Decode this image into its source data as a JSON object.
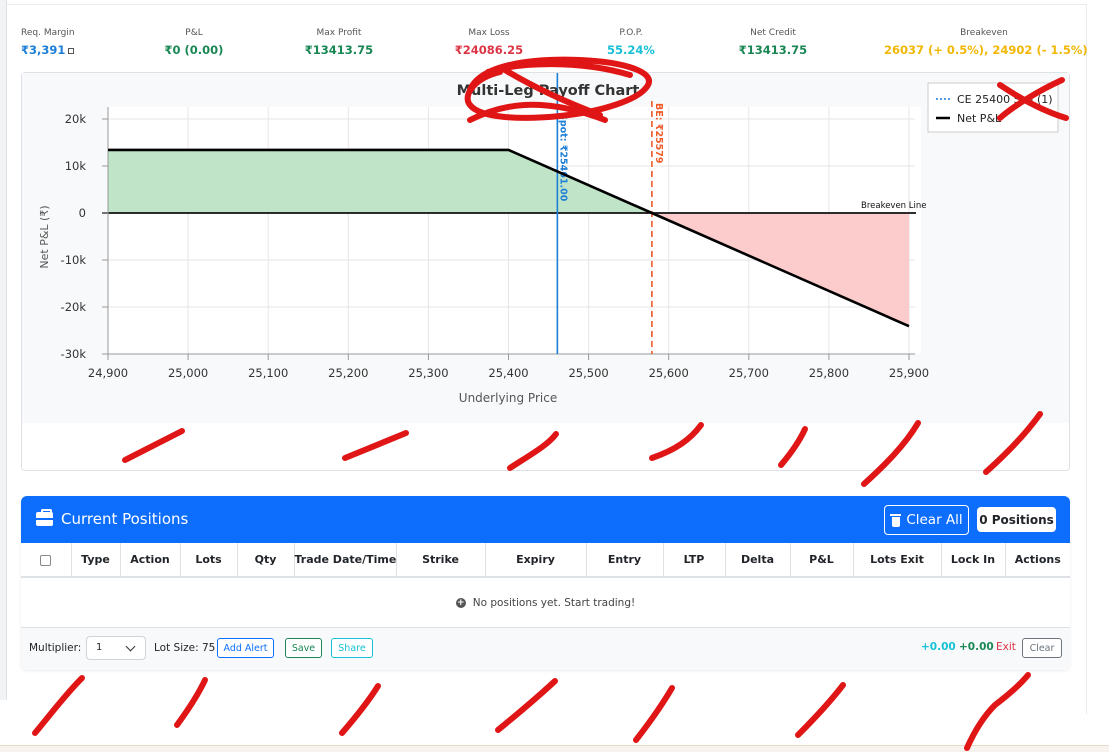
{
  "metrics": {
    "req_margin": {
      "label": "Req. Margin",
      "value": "₹3,391"
    },
    "pnl": {
      "label": "P&L",
      "value": "₹0 (0.00)"
    },
    "max_profit": {
      "label": "Max Profit",
      "value": "₹13413.75"
    },
    "max_loss": {
      "label": "Max Loss",
      "value": "₹24086.25"
    },
    "pop": {
      "label": "P.O.P.",
      "value": "55.24%"
    },
    "net_credit": {
      "label": "Net Credit",
      "value": "₹13413.75"
    },
    "breakeven": {
      "label": "Breakeven",
      "value": "26037 (+ 0.5%), 24902 (- 1.5%)"
    }
  },
  "chart_data": {
    "type": "line",
    "title": "Multi-Leg Payoff Chart",
    "xlabel": "Underlying Price",
    "ylabel": "Net P&L (₹)",
    "xlim": [
      24900,
      25900
    ],
    "ylim": [
      -30000,
      20000
    ],
    "x_ticks": [
      "24,900",
      "25,000",
      "25,100",
      "25,200",
      "25,300",
      "25,400",
      "25,500",
      "25,600",
      "25,700",
      "25,800",
      "25,900"
    ],
    "y_ticks": [
      "20k",
      "10k",
      "0",
      "-10k",
      "-20k",
      "-30k"
    ],
    "grid": true,
    "legend_position": "top-right",
    "legend": [
      "CE 25400 Sell (1)",
      "Net P&L"
    ],
    "series": [
      {
        "name": "Net P&L",
        "x": [
          24900,
          25400,
          25579,
          25900
        ],
        "y": [
          13413.75,
          13413.75,
          0,
          -24086.25
        ]
      }
    ],
    "spot_line": {
      "x": 25461,
      "label": "Spot: ₹25461.00"
    },
    "breakeven_marker": {
      "x": 25579,
      "label": "BE: ₹25579"
    },
    "zero_line_label": "Breakeven Line"
  },
  "positions": {
    "title": "Current Positions",
    "clear_all": "Clear All",
    "count": "0 Positions",
    "columns": [
      "Type",
      "Action",
      "Lots",
      "Qty",
      "Trade Date/Time",
      "Strike",
      "Expiry",
      "Entry",
      "LTP",
      "Delta",
      "P&L",
      "Lots Exit",
      "Lock In",
      "Actions"
    ],
    "empty_message": "No positions yet. Start trading!",
    "footer": {
      "multiplier_label": "Multiplier:",
      "multiplier_value": "1",
      "lot_size": "Lot Size: 75",
      "add_alert": "Add Alert",
      "save": "Save",
      "share": "Share",
      "value1": "+0.00",
      "value2": "+0.00",
      "exit": "Exit",
      "clear": "Clear"
    }
  },
  "colors": {
    "accent_blue": "#0d6efd",
    "profit_green": "#198754",
    "loss_red": "#dc3545",
    "pop_cyan": "#17c1d6",
    "breakeven_amber": "#f2b705",
    "profit_fill": "#bde3c4",
    "loss_fill": "#fcc8c8"
  }
}
